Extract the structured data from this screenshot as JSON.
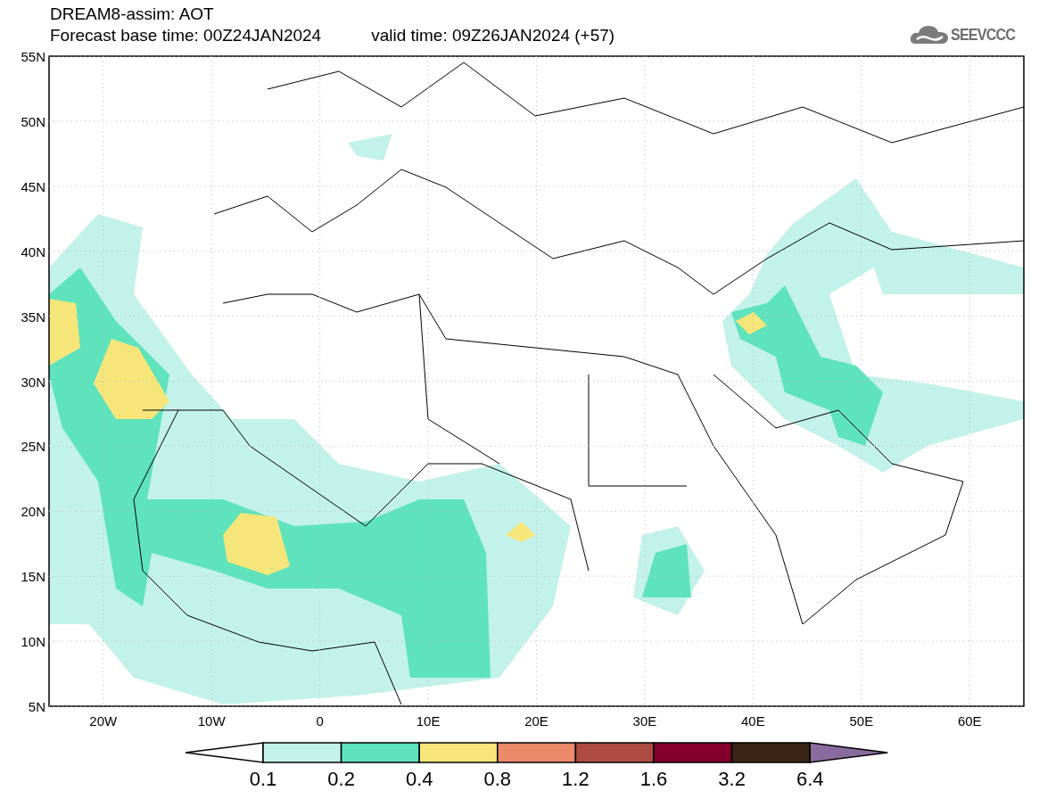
{
  "title": "DREAM8-assim: AOT",
  "base_time": "Forecast base time: 00Z24JAN2024",
  "valid_time": "valid time: 09Z26JAN2024 (+57)",
  "logo": "SEEVCCC",
  "map": {
    "y_labels": [
      "55N",
      "50N",
      "45N",
      "40N",
      "35N",
      "30N",
      "25N",
      "20N",
      "15N",
      "10N",
      "5N"
    ],
    "x_labels": [
      "20W",
      "10W",
      "0",
      "10E",
      "20E",
      "30E",
      "40E",
      "50E",
      "60E"
    ]
  },
  "legend": {
    "bins": [
      {
        "kind": "under",
        "color": "#ffffff"
      },
      {
        "color": "#c3f2ea"
      },
      {
        "color": "#5ee3bc"
      },
      {
        "color": "#f6e67a"
      },
      {
        "color": "#ea8a69"
      },
      {
        "color": "#ad4b42"
      },
      {
        "color": "#82002b"
      },
      {
        "color": "#3a2413"
      },
      {
        "kind": "over",
        "color": "#8a6b9e"
      }
    ],
    "labels": [
      "0.1",
      "0.2",
      "0.4",
      "0.8",
      "1.2",
      "1.6",
      "3.2",
      "6.4"
    ]
  }
}
